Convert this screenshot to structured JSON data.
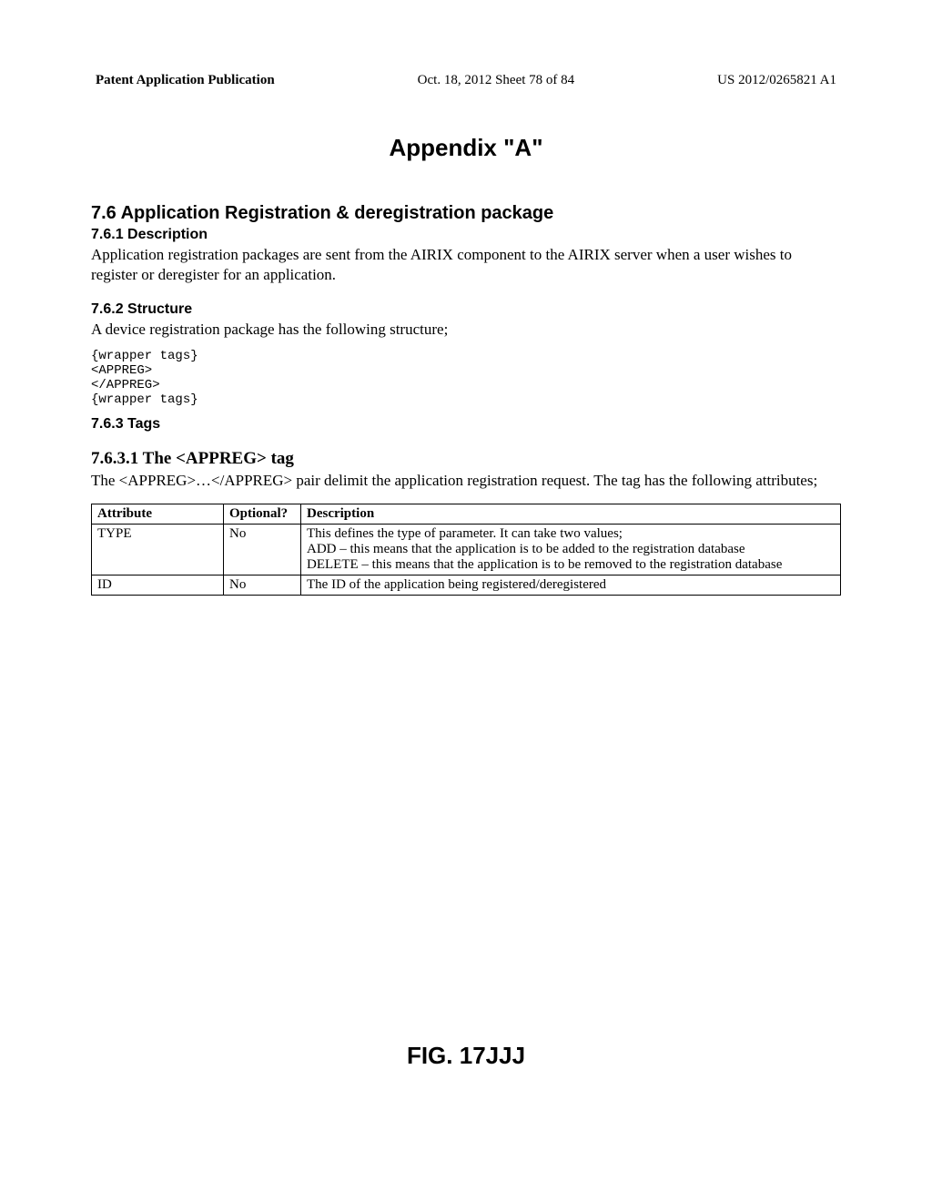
{
  "header": {
    "left": "Patent Application Publication",
    "center": "Oct. 18, 2012  Sheet 78 of 84",
    "right": "US 2012/0265821 A1"
  },
  "appendix_title": "Appendix \"A\"",
  "s76": {
    "heading": "7.6  Application Registration & deregistration package"
  },
  "s761": {
    "heading": "7.6.1  Description",
    "text": "Application registration packages are sent from the AIRIX component to the AIRIX server when a user wishes to register or deregister for an application."
  },
  "s762": {
    "heading": "7.6.2  Structure",
    "text": "A device registration package has the following structure;",
    "code": "{wrapper tags}\n<APPREG>\n</APPREG>\n{wrapper tags}"
  },
  "s763": {
    "heading": "7.6.3  Tags"
  },
  "s7631": {
    "heading": "7.6.3.1  The <APPREG> tag",
    "text": "The <APPREG>…</APPREG> pair delimit the application registration request. The tag has the following attributes;"
  },
  "table": {
    "th1": "Attribute",
    "th2": "Optional?",
    "th3": "Description",
    "rows": [
      {
        "attr": "TYPE",
        "opt": "No",
        "desc": "This defines the type of parameter. It can take two values;\nADD – this means that the application is to be added to the registration database\nDELETE – this means that the application is to be removed to the registration database"
      },
      {
        "attr": "ID",
        "opt": "No",
        "desc": "The ID of the application being registered/deregistered"
      }
    ]
  },
  "figure_label": "FIG. 17JJJ"
}
